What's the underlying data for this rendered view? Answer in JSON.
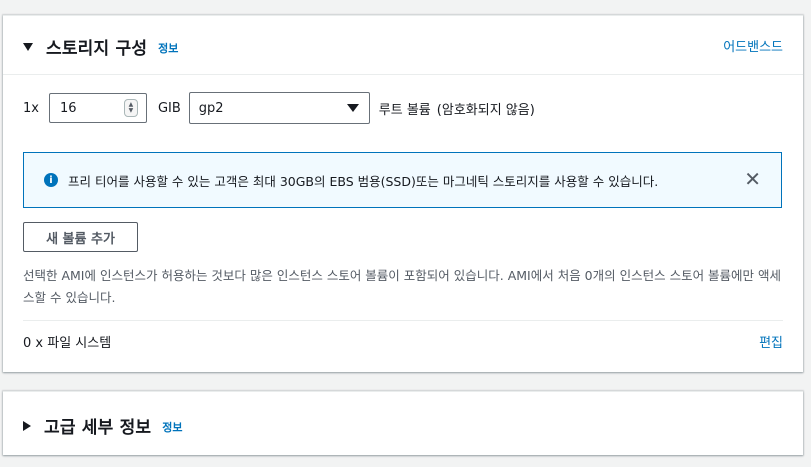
{
  "storage": {
    "title": "스토리지 구성",
    "info_label": "정보",
    "advanced_label": "어드밴스드",
    "volume": {
      "count_label": "1x",
      "size_value": "16",
      "unit_label": "GIB",
      "type_value": "gp2",
      "root_label": "루트 볼륨",
      "encryption_note": "(암호화되지 않음)"
    },
    "alert": {
      "icon": "info-circle-icon",
      "text": "프리 티어를 사용할 수 있는 고객은 최대 30GB의 EBS 범용(SSD)또는 마그네틱 스토리지를 사용할 수 있습니다.",
      "close_icon": "close-icon"
    },
    "add_volume_label": "새 볼륨 추가",
    "help_text": "선택한 AMI에 인스턴스가 허용하는 것보다 많은 인스턴스 스토어 볼륨이 포함되어 있습니다. AMI에서 처음 0개의 인스턴스 스토어 볼륨에만 액세스할 수 있습니다.",
    "file_systems_label": "0 x 파일 시스템",
    "edit_label": "편집"
  },
  "advanced_details": {
    "title": "고급 세부 정보",
    "info_label": "정보"
  },
  "colors": {
    "link": "#0073bb",
    "alert_border": "#0073bb",
    "alert_background": "#f1faff",
    "page_background": "#f2f3f3"
  }
}
